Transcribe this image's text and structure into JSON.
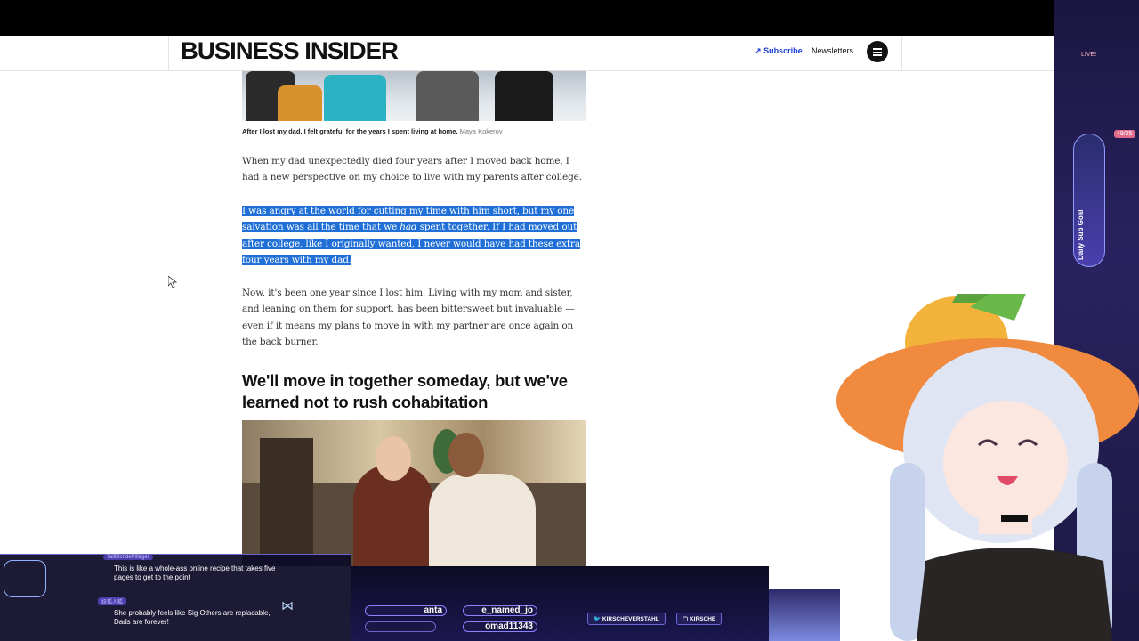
{
  "site": {
    "logo": "BUSINESS INSIDER",
    "subscribe_label": "Subscribe",
    "newsletters_label": "Newsletters"
  },
  "article": {
    "caption_text": "After I lost my dad, I felt grateful for the years I spent living at home.",
    "caption_credit": "Maya Kokerov",
    "para1": "When my dad unexpectedly died four years after I moved back home, I had a new perspective on my choice to live with my parents after college.",
    "para2_line1": "I was angry at the world for cutting my time with him short, but my one",
    "para2_line2a": "salvation was all the time that we ",
    "para2_line2_em": "had",
    "para2_line2b": " spent together. If I had moved out",
    "para2_line3": "after college, like I originally wanted, I never would have had these extra",
    "para2_line4": "four years with my dad.",
    "para3": "Now, it's been one year since I lost him. Living with my mom and sister, and leaning on them for support, has been bittersweet but invaluable — even if it means my plans to move in with my partner are once again on the back burner.",
    "heading": "We'll move in together someday, but we've learned not to rush cohabitation"
  },
  "overlay": {
    "live_label": "LIVE!",
    "goal_label": "Daily Sub Goal",
    "goal_count": "49/25",
    "chat": [
      {
        "user": "TallBlondePillager",
        "text": "This is like a whole-ass online recipe that takes five pages to get to the point"
      },
      {
        "user": "妖狐人狐",
        "text": "She probably feels like Sig Others are replacable, Dads are forever!"
      }
    ],
    "ticker": [
      "anta",
      "e_named_jo",
      "omad11343"
    ],
    "socials": [
      "KIRSCHEVERSTAHL",
      "KIRSCHE"
    ]
  }
}
